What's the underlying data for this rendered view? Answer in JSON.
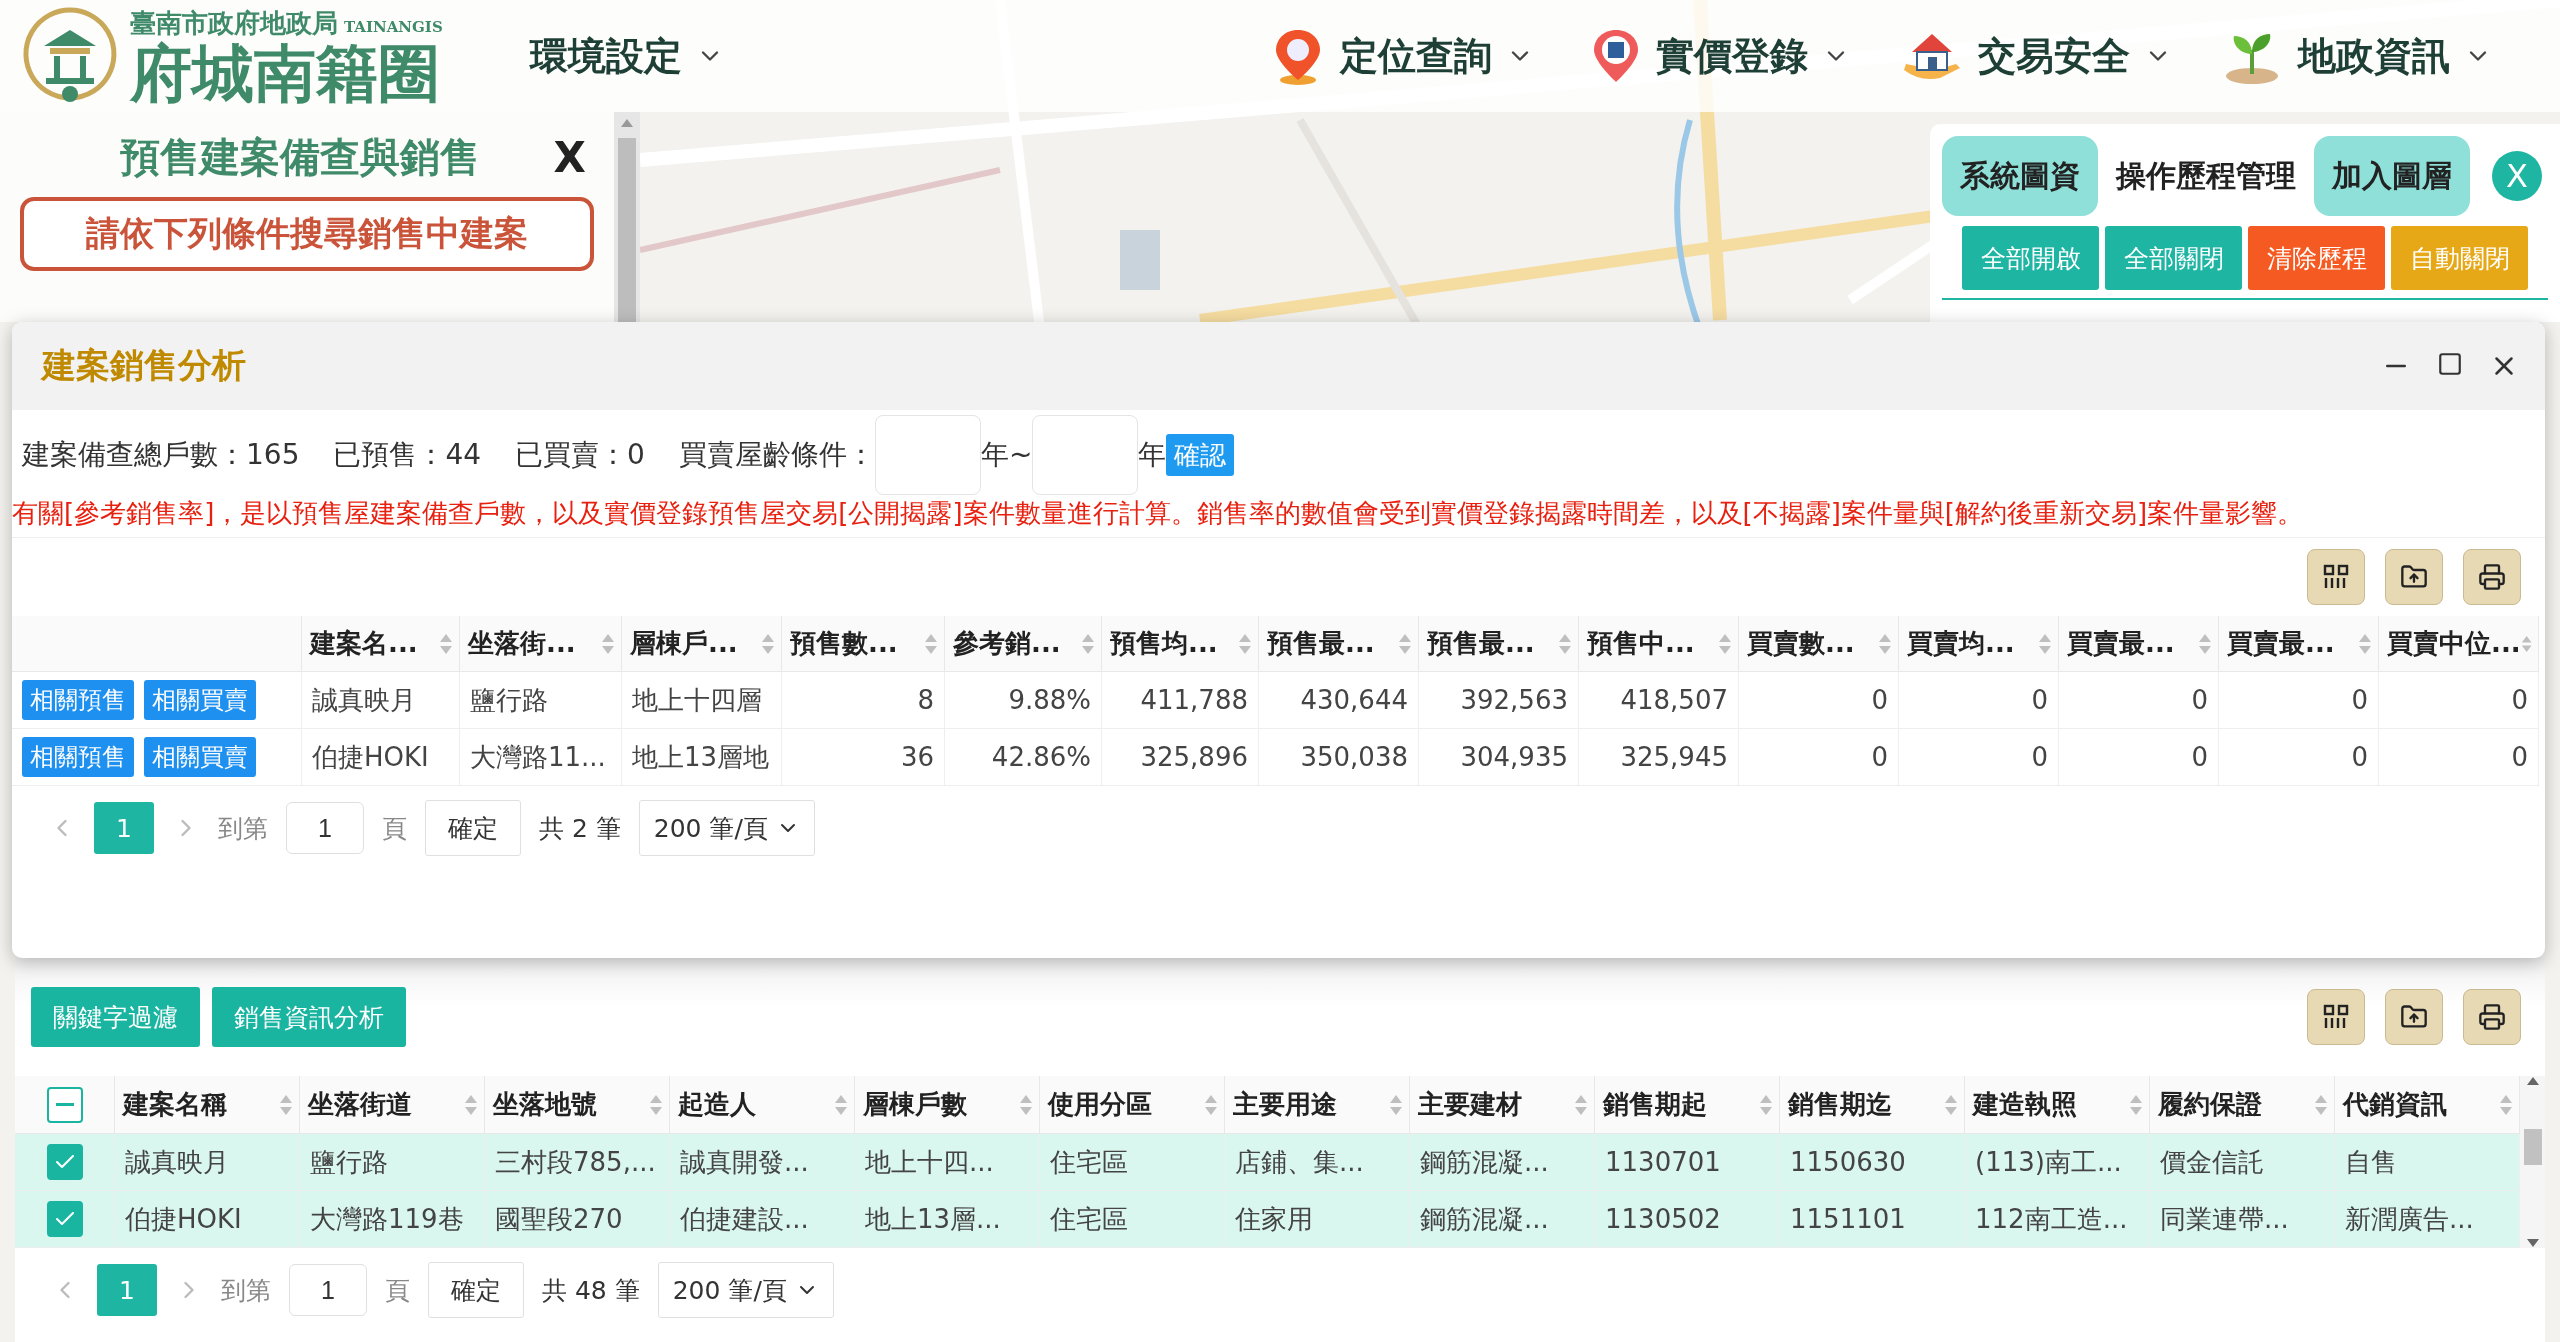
{
  "header": {
    "logo": {
      "agency": "臺南市政府地政局",
      "agency_en": "TAINANGIS",
      "name": "府城南籍圈"
    },
    "menu": [
      {
        "label": "環境設定"
      },
      {
        "label": "定位查詢"
      },
      {
        "label": "實價登錄"
      },
      {
        "label": "交易安全"
      },
      {
        "label": "地政資訊"
      }
    ]
  },
  "left_panel": {
    "title": "預售建案備查與銷售",
    "close": "X",
    "search_button": "請依下列條件搜尋銷售中建案"
  },
  "right_panel": {
    "tabs": [
      {
        "label": "系統圖資",
        "selected": false
      },
      {
        "label": "操作歷程管理",
        "selected": true
      },
      {
        "label": "加入圖層",
        "selected": false
      }
    ],
    "close": "X",
    "actions": [
      {
        "label": "全部開啟",
        "color": "#1fb5a3"
      },
      {
        "label": "全部關閉",
        "color": "#1fb5a3"
      },
      {
        "label": "清除歷程",
        "color": "#f55a22"
      },
      {
        "label": "自動關閉",
        "color": "#e6a817"
      }
    ]
  },
  "dialog": {
    "title": "建案銷售分析",
    "stats": [
      "建案備查總戶數：165",
      "已預售：44",
      "已買賣：0"
    ],
    "age_filter": {
      "label": "買賣屋齡條件：",
      "unit_from": "年~",
      "unit_to": "年",
      "confirm": "確認"
    },
    "note": "有關[參考銷售率]，是以預售屋建案備查戶數，以及實價登錄預售屋交易[公開揭露]案件數量進行計算。銷售率的數值會受到實價登錄揭露時間差，以及[不揭露]案件量與[解約後重新交易]案件量影響。",
    "table": {
      "columns": [
        "建案名...",
        "坐落街...",
        "層棟戶...",
        "預售數...",
        "參考銷...",
        "預售均...",
        "預售最...",
        "預售最...",
        "預售中...",
        "買賣數...",
        "買賣均...",
        "買賣最...",
        "買賣最...",
        "買賣中位..."
      ],
      "rows": [
        {
          "actions": [
            "相關預售",
            "相關買賣"
          ],
          "cells": [
            "誠真映月",
            "鹽行路",
            "地上十四層",
            "8",
            "9.88%",
            "411,788",
            "430,644",
            "392,563",
            "418,507",
            "0",
            "0",
            "0",
            "0",
            "0"
          ]
        },
        {
          "actions": [
            "相關預售",
            "相關買賣"
          ],
          "cells": [
            "伯捷HOKI",
            "大灣路11...",
            "地上13層地",
            "36",
            "42.86%",
            "325,896",
            "350,038",
            "304,935",
            "325,945",
            "0",
            "0",
            "0",
            "0",
            "0"
          ]
        }
      ]
    },
    "pagination": {
      "pages": [
        {
          "label": "1",
          "selected": true
        }
      ],
      "goto_label": "到第",
      "goto_value": "1",
      "page_unit": "頁",
      "confirm": "確定",
      "total": "共 2 筆",
      "page_size": "200 筆/頁"
    }
  },
  "sales_panel": {
    "buttons": [
      "關鍵字過濾",
      "銷售資訊分析"
    ],
    "table": {
      "select_all": {
        "indeterminate": true
      },
      "columns": [
        "建案名稱",
        "坐落街道",
        "坐落地號",
        "起造人",
        "層棟戶數",
        "使用分區",
        "主要用途",
        "主要建材",
        "銷售期起",
        "銷售期迄",
        "建造執照",
        "履約保證",
        "代銷資訊"
      ],
      "rows": [
        {
          "checked": true,
          "cells": [
            "誠真映月",
            "鹽行路",
            "三村段785,...",
            "誠真開發...",
            "地上十四...",
            "住宅區",
            "店鋪、集...",
            "鋼筋混凝...",
            "1130701",
            "1150630",
            "(113)南工...",
            "價金信託",
            "自售"
          ]
        },
        {
          "checked": true,
          "cells": [
            "伯捷HOKI",
            "大灣路119巷",
            "國聖段270",
            "伯捷建設...",
            "地上13層...",
            "住宅區",
            "住家用",
            "鋼筋混凝...",
            "1130502",
            "1151101",
            "112南工造...",
            "同業連帶...",
            "新潤廣告..."
          ]
        }
      ]
    },
    "pagination": {
      "pages": [
        {
          "label": "1",
          "selected": true
        }
      ],
      "goto_label": "到第",
      "goto_value": "1",
      "page_unit": "頁",
      "confirm": "確定",
      "total": "共 48 筆",
      "page_size": "200 筆/頁"
    }
  }
}
